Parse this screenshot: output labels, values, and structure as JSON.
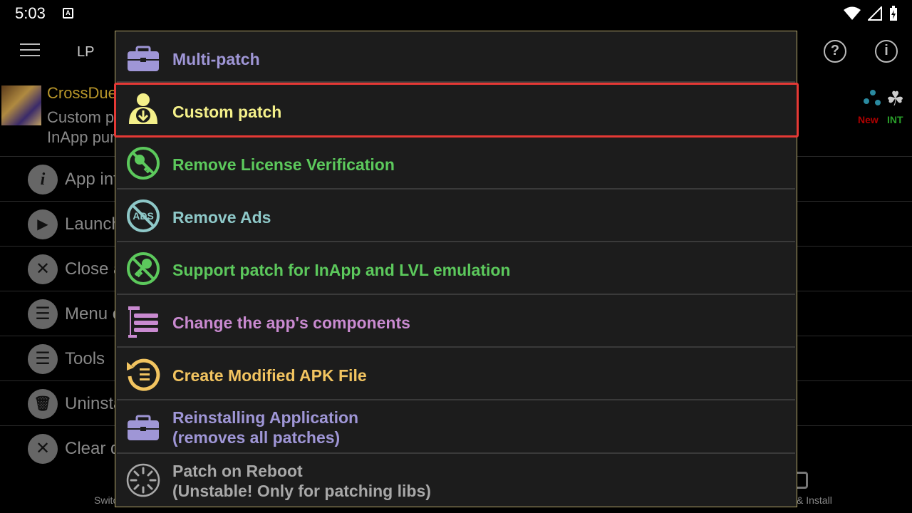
{
  "status_bar": {
    "time": "5:03",
    "notification_icon": "A"
  },
  "app_bar": {
    "title": "LP"
  },
  "app": {
    "name": "CrossDuel",
    "line1": "Custom patch",
    "line2": "InApp purchases",
    "badge_new": "New",
    "badge_int": "INT"
  },
  "bg_menu": [
    {
      "icon": "info-icon",
      "glyph": "i",
      "label": "App info"
    },
    {
      "icon": "play-icon",
      "glyph": "▶",
      "label": "Launch"
    },
    {
      "icon": "close-icon",
      "glyph": "✕",
      "label": "Close app"
    },
    {
      "icon": "list-icon",
      "glyph": "☰",
      "label": "Menu of patches"
    },
    {
      "icon": "list-icon",
      "glyph": "☰",
      "label": "Tools"
    },
    {
      "icon": "trash-icon",
      "glyph": "🗑",
      "label": "Uninstall"
    },
    {
      "icon": "close-icon",
      "glyph": "✕",
      "label": "Clear data"
    }
  ],
  "bottom_nav": {
    "left_label": "Switch",
    "right_label": "& Install"
  },
  "dialog": {
    "items": [
      {
        "line1": "Multi-patch",
        "line2": "",
        "color": "#9f96d6",
        "icon": "toolbox-icon"
      },
      {
        "line1": "Custom patch",
        "line2": "",
        "color": "#f4f08a",
        "icon": "person-download-icon"
      },
      {
        "line1": "Remove License Verification",
        "line2": "",
        "color": "#5cc95c",
        "icon": "no-key-icon"
      },
      {
        "line1": "Remove Ads",
        "line2": "",
        "color": "#8ec8c8",
        "icon": "no-ads-icon"
      },
      {
        "line1": "Support patch for InApp and LVL emulation",
        "line2": "",
        "color": "#5cc95c",
        "icon": "no-key-icon"
      },
      {
        "line1": "Change the app's components",
        "line2": "",
        "color": "#c98ad0",
        "icon": "components-icon"
      },
      {
        "line1": "Create Modified APK File",
        "line2": "",
        "color": "#f2c460",
        "icon": "rebuild-icon"
      },
      {
        "line1": "Reinstalling Application",
        "line2": "(removes all patches)",
        "color": "#9f96d6",
        "icon": "toolbox-icon"
      },
      {
        "line1": "Patch on Reboot",
        "line2": "(Unstable! Only for patching libs)",
        "color": "#a8a8a8",
        "icon": "spinner-icon"
      }
    ]
  }
}
